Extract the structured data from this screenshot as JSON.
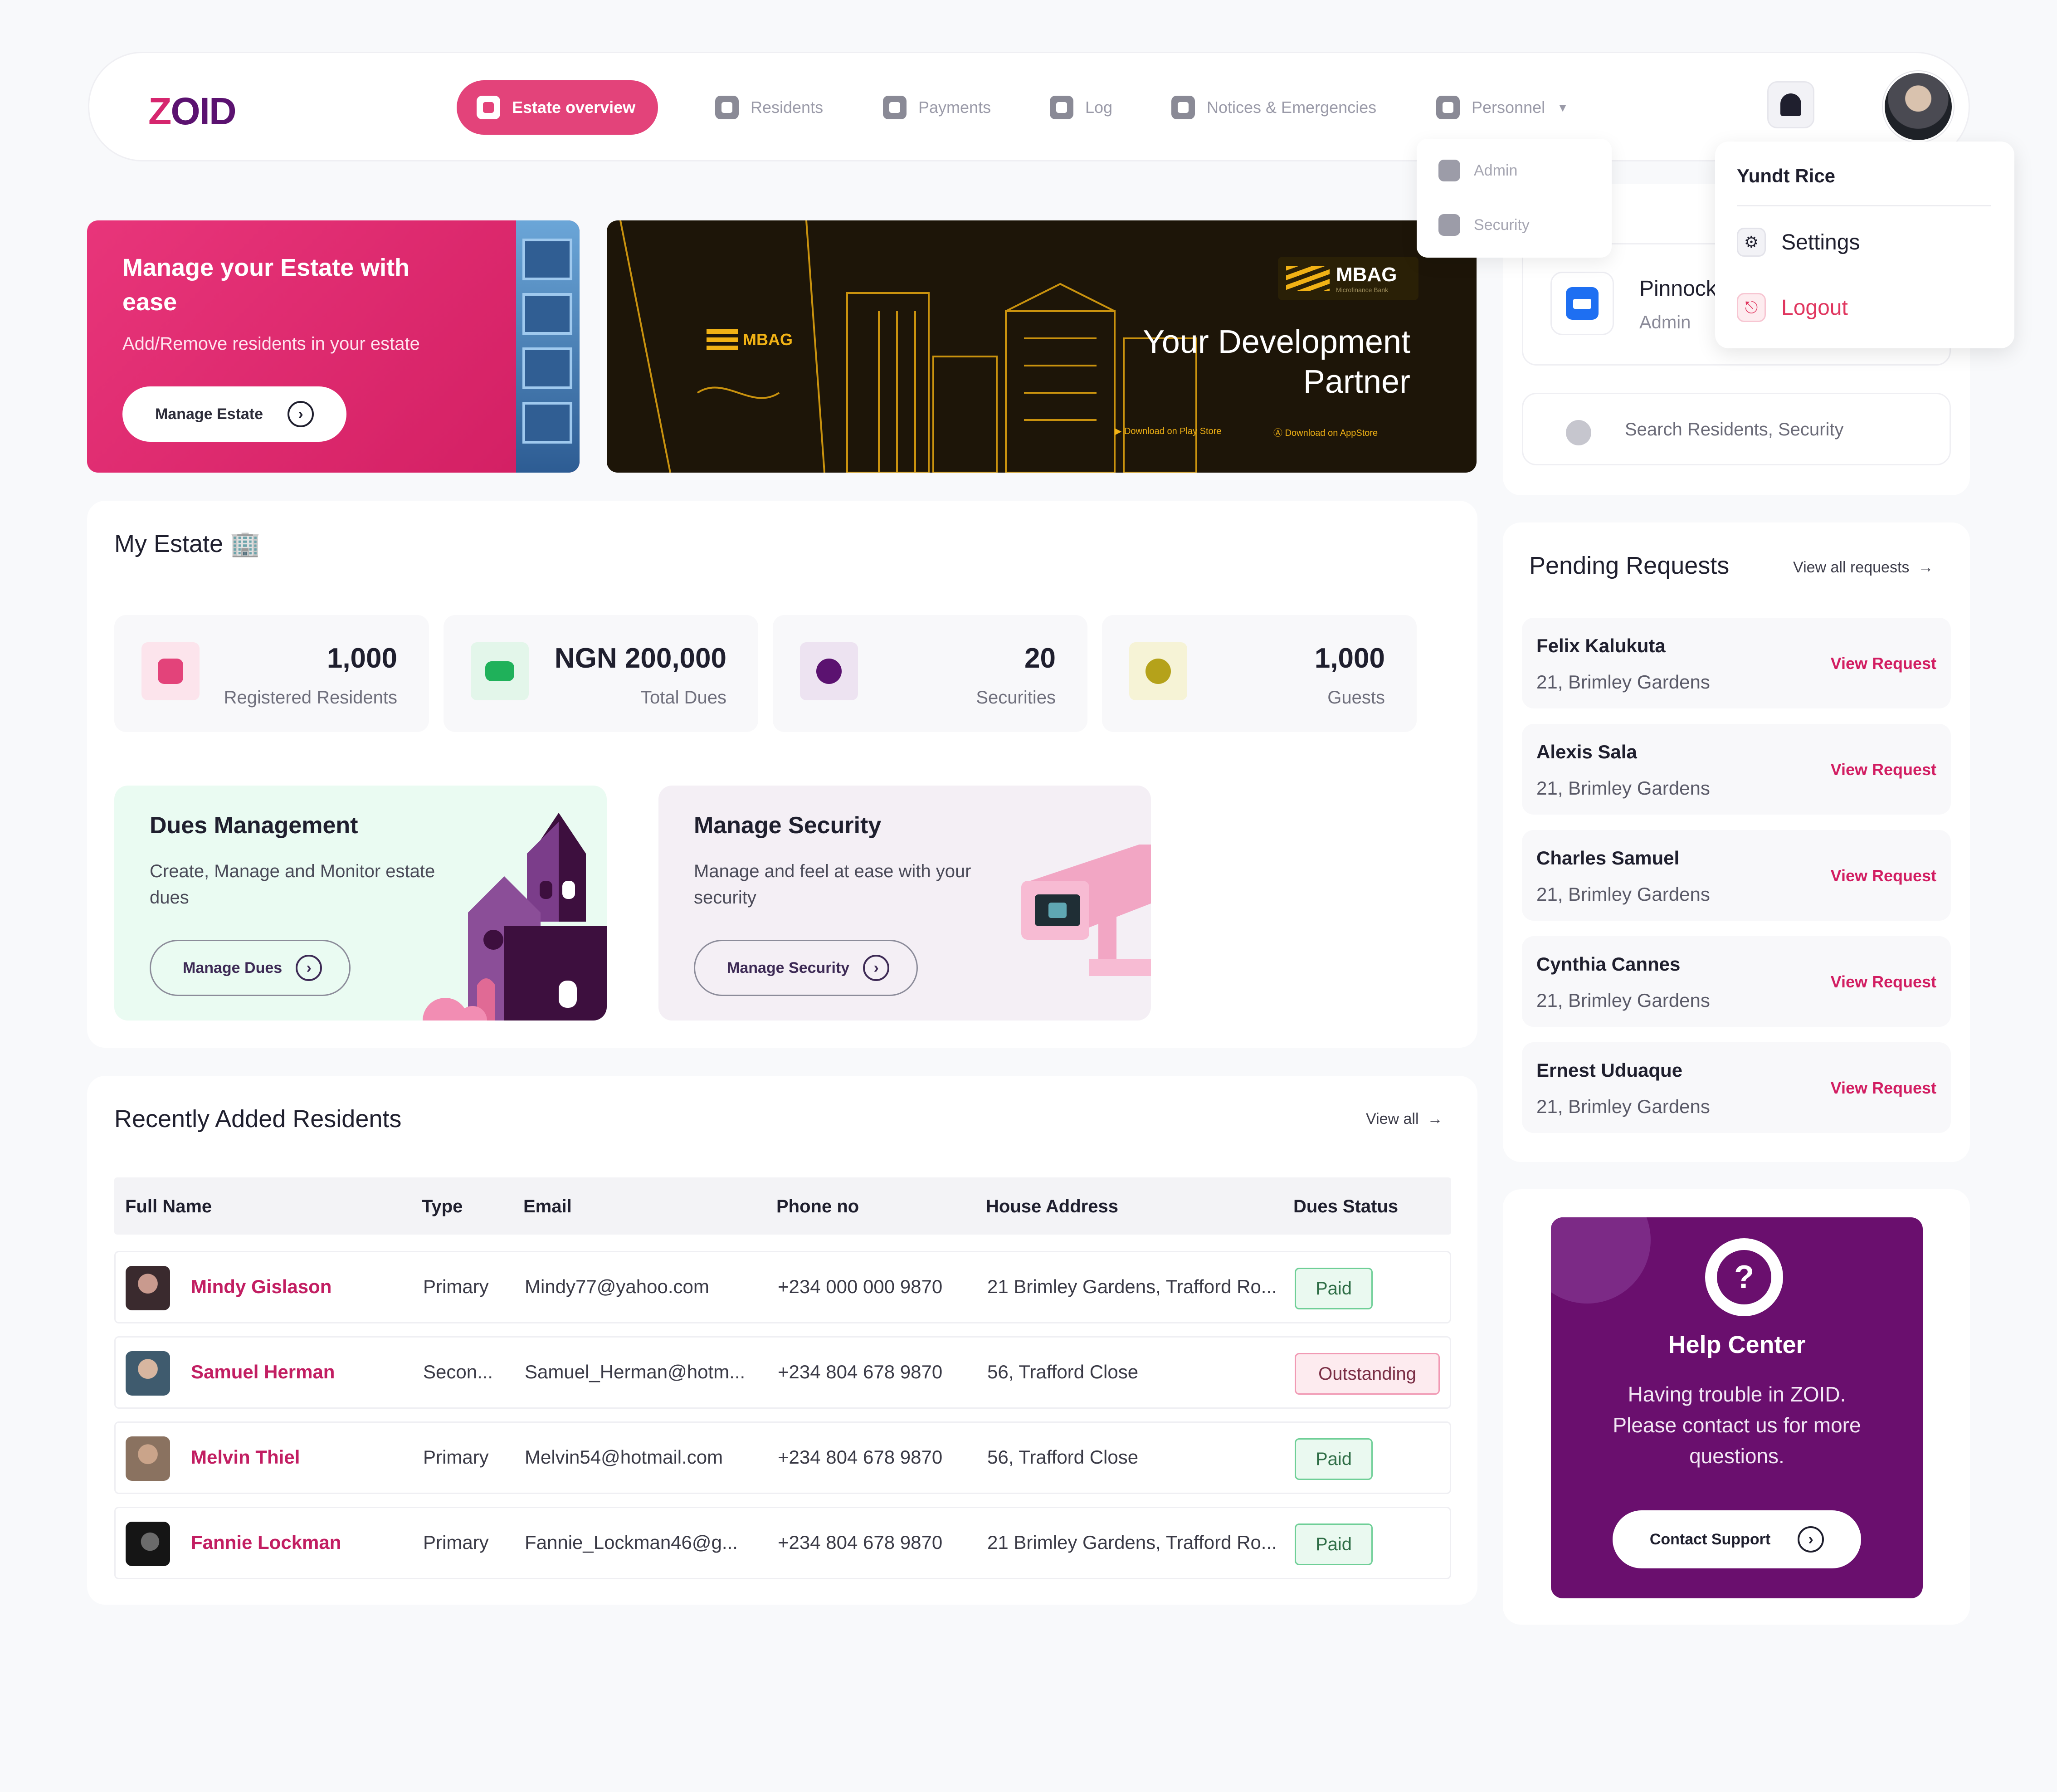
{
  "brand": {
    "logo_z": "Z",
    "logo_rest": "OID"
  },
  "nav": {
    "items": [
      {
        "label": "Estate overview",
        "icon": "home-icon",
        "active": true
      },
      {
        "label": "Residents",
        "icon": "user-icon"
      },
      {
        "label": "Payments",
        "icon": "money-icon"
      },
      {
        "label": "Log",
        "icon": "log-icon"
      },
      {
        "label": "Notices & Emergencies",
        "icon": "book-icon"
      },
      {
        "label": "Personnel",
        "icon": "person-badge-icon",
        "dropdown": true
      }
    ]
  },
  "personnel_menu": {
    "items": [
      "Admin",
      "Security"
    ]
  },
  "profile_menu": {
    "name": "Yundt Rice",
    "settings": "Settings",
    "logout": "Logout"
  },
  "hero": {
    "title": "Manage your Estate with ease",
    "subtitle": "Add/Remove residents in your estate",
    "button": "Manage Estate"
  },
  "banner": {
    "brand": "MBAG",
    "brand_tag": "Microfinance Bank",
    "title": "Your Development Partner",
    "download_play": "Download on Play Store",
    "download_app": "Download on AppStore"
  },
  "org": {
    "name": "Pinnock",
    "role": "Admin",
    "search_placeholder": "Search Residents, Security"
  },
  "estate": {
    "title": "My Estate 🏢",
    "stats": [
      {
        "value": "1,000",
        "label": "Registered Residents",
        "color": "#E3437A",
        "bg": "#FCE4EC"
      },
      {
        "value": "NGN 200,000",
        "label": "Total Dues",
        "color": "#1FB15A",
        "bg": "#E3F6EA"
      },
      {
        "value": "20",
        "label": "Securities",
        "color": "#5B1270",
        "bg": "#EDE3F1"
      },
      {
        "value": "1,000",
        "label": "Guests",
        "color": "#B5A21A",
        "bg": "#F6F3D6"
      }
    ],
    "dues": {
      "title": "Dues Management",
      "desc": "Create, Manage and Monitor estate dues",
      "button": "Manage Dues"
    },
    "security": {
      "title": "Manage Security",
      "desc": "Manage and feel at ease with your security",
      "button": "Manage Security"
    }
  },
  "residents": {
    "title": "Recently Added Residents",
    "view_all": "View all",
    "columns": [
      "Full Name",
      "Type",
      "Email",
      "Phone no",
      "House Address",
      "Dues Status"
    ],
    "rows": [
      {
        "name": "Mindy Gislason",
        "type": "Primary",
        "email": "Mindy77@yahoo.com",
        "phone": "+234 000 000 9870",
        "address": "21 Brimley Gardens, Trafford Ro...",
        "status": "Paid"
      },
      {
        "name": "Samuel Herman",
        "type": "Secon...",
        "email": "Samuel_Herman@hotm...",
        "phone": "+234 804 678 9870",
        "address": "56, Trafford Close",
        "status": "Outstanding"
      },
      {
        "name": "Melvin Thiel",
        "type": "Primary",
        "email": "Melvin54@hotmail.com",
        "phone": "+234 804 678 9870",
        "address": "56, Trafford Close",
        "status": "Paid"
      },
      {
        "name": "Fannie Lockman",
        "type": "Primary",
        "email": "Fannie_Lockman46@g...",
        "phone": "+234 804 678 9870",
        "address": "21 Brimley Gardens, Trafford Ro...",
        "status": "Paid"
      }
    ]
  },
  "pending": {
    "title": "Pending Requests",
    "view_all": "View all requests",
    "action": "View  Request",
    "items": [
      {
        "name": "Felix Kalukuta",
        "address": "21, Brimley Gardens"
      },
      {
        "name": "Alexis Sala",
        "address": "21, Brimley Gardens"
      },
      {
        "name": "Charles Samuel",
        "address": "21, Brimley Gardens"
      },
      {
        "name": "Cynthia Cannes",
        "address": "21, Brimley Gardens"
      },
      {
        "name": "Ernest Uduaque",
        "address": "21, Brimley Gardens"
      }
    ]
  },
  "help": {
    "icon_glyph": "?",
    "title": "Help Center",
    "text": "Having trouble in ZOID. Please contact us for more questions.",
    "button": "Contact Support"
  }
}
